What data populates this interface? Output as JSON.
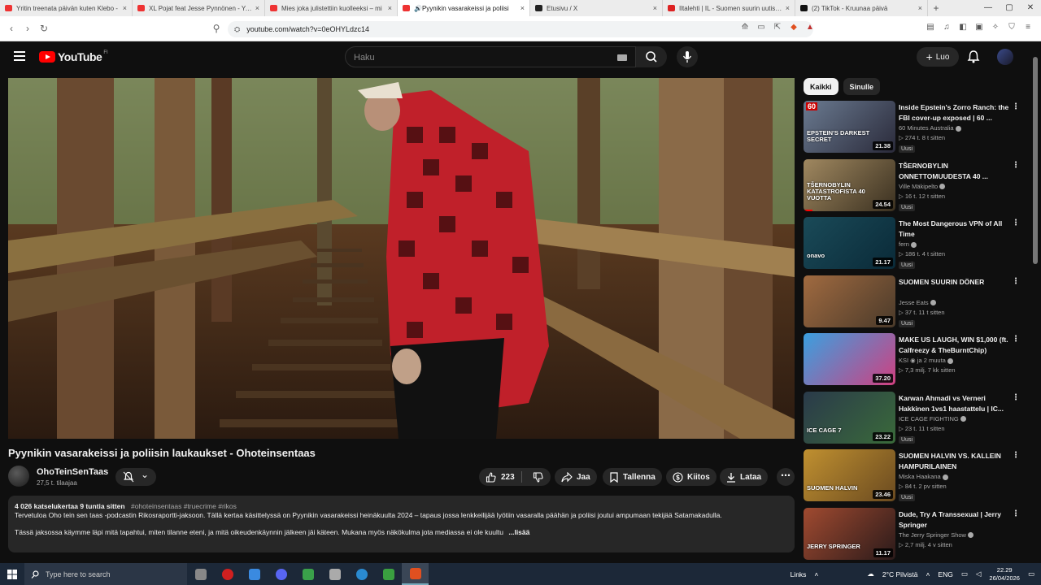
{
  "browser": {
    "tabs": [
      {
        "label": "Yritin treenata päivän kuten Klebo - ",
        "favicon_color": "#e33"
      },
      {
        "label": "XL Pojat feat Jesse Pynnönen - You",
        "favicon_color": "#e33"
      },
      {
        "label": "Mies joka julistettiin kuolleeksi – mi",
        "favicon_color": "#e33"
      },
      {
        "label": "Pyynikin vasarakeissi ja poliisi",
        "favicon_color": "#e33",
        "audio": "🔊"
      },
      {
        "label": "Etusivu / X",
        "favicon_color": "#222"
      },
      {
        "label": "Iltalehti | IL - Suomen suurin uutispa",
        "favicon_color": "#d22"
      },
      {
        "label": "(2) TikTok - Kruunaa päivä",
        "favicon_color": "#111"
      }
    ],
    "close_glyph": "×",
    "new_tab": "+",
    "url": "youtube.com/watch?v=0eOHYLdzc14",
    "window_controls": [
      "—",
      "▢",
      "✕"
    ]
  },
  "header": {
    "logo_word": "YouTube",
    "country_code": "FI",
    "search_placeholder": "Haku",
    "create_label": "Luo",
    "create_plus": "+"
  },
  "video": {
    "title": "Pyynikin vasarakeissi ja poliisin laukaukset - Ohoteinsentaas"
  },
  "channel": {
    "name": "OhoTeinSenTaas",
    "subscribers": "27,5 t. tilaajaa",
    "bell_caret": "⌄"
  },
  "actions": {
    "likes": "223",
    "share": "Jaa",
    "save": "Tallenna",
    "thanks": "Kiitos",
    "download": "Lataa",
    "more": "⋯"
  },
  "description": {
    "meta": "4 026 katselukertaa  9 tuntia sitten",
    "tags": "#ohoteinsentaas #truecrime #rikos",
    "line1": "Tervetuloa Oho tein sen taas -podcastin Rikosraportti-jaksoon. Tällä kertaa käsittelyssä on Pyynikin vasarakeissi heinäkuulta 2024 – tapaus jossa lenkkeilijää lyötiin vasaralla päähän ja poliisi joutui ampumaan tekijää Satamakadulla.",
    "line2": "Tässä jaksossa käymme läpi mitä tapahtui, miten tilanne eteni, ja mitä oikeudenkäynnin jälkeen jäi käteen. Mukana myös näkökulma jota mediassa ei ole kuultu",
    "more": "...lisää"
  },
  "sidebar": {
    "chips": [
      "Kaikki",
      "Sinulle"
    ],
    "menu_glyph": "⋮",
    "new_badge": "Uusi",
    "items": [
      {
        "title": "Inside Epstein's Zorro Ranch: the FBI cover-up exposed | 60 ...",
        "channel": "60 Minutes Australia",
        "stats": "▷ 274 t.  8 t sitten",
        "duration": "21.38",
        "thumb_text": "EPSTEIN'S DARKEST SECRET",
        "thumb_badge": "60",
        "c1": "#6a7a90",
        "c2": "#2a2a3a",
        "new": true,
        "progress": 0
      },
      {
        "title": "TŠERNOBYLIN ONNETTOMUUDESTA 40 ...",
        "channel": "Ville Mäkipelto",
        "stats": "▷ 16 t.  12 t sitten",
        "duration": "24.54",
        "thumb_text": "TŠERNOBYLIN KATASTROFISTA 40 VUOTTA",
        "thumb_badge": "",
        "c1": "#a08860",
        "c2": "#3a3020",
        "new": true,
        "progress": 0.1
      },
      {
        "title": "The Most Dangerous VPN of All Time",
        "channel": "fern",
        "stats": "▷ 186 t.  4 t sitten",
        "duration": "21.17",
        "thumb_text": "onavo",
        "thumb_badge": "",
        "c1": "#1a4a58",
        "c2": "#0a2a38",
        "new": true,
        "progress": 0
      },
      {
        "title": "SUOMEN SUURIN DÖNER",
        "channel": "Jesse Eats",
        "stats": "▷ 37 t.  11 t sitten",
        "duration": "9.47",
        "thumb_text": "",
        "thumb_badge": "",
        "c1": "#a06a40",
        "c2": "#4a3a2a",
        "new": true,
        "progress": 0
      },
      {
        "title": "MAKE US LAUGH, WIN $1,000 (ft. Calfreezy & TheBurntChip)",
        "channel": "KSI ◉ ja 2 muuta",
        "stats": "▷ 7,3 milj.  7 kk sitten",
        "duration": "37.20",
        "thumb_text": "",
        "thumb_badge": "",
        "c1": "#3aa0e0",
        "c2": "#d04080",
        "new": false,
        "progress": 0
      },
      {
        "title": "Karwan Ahmadi vs Verneri Hakkinen 1vs1 haastattelu | IC...",
        "channel": "ICE CAGE FIGHTING",
        "stats": "▷ 23 t.  11 t sitten",
        "duration": "23.22",
        "thumb_text": "ICE CAGE 7",
        "thumb_badge": "",
        "c1": "#2a3a4a",
        "c2": "#3a6a3a",
        "new": true,
        "progress": 0
      },
      {
        "title": "SUOMEN HALVIN VS. KALLEIN HAMPURILAINEN",
        "channel": "Miska Haakana",
        "stats": "▷ 84 t.  2 pv sitten",
        "duration": "23.46",
        "thumb_text": "SUOMEN HALVIN",
        "thumb_badge": "",
        "c1": "#c09030",
        "c2": "#6a4a20",
        "new": true,
        "progress": 0
      },
      {
        "title": "Dude, Try A Transsexual | Jerry Springer",
        "channel": "The Jerry Springer Show",
        "stats": "▷ 2,7 milj.  4 v sitten",
        "duration": "11.17",
        "thumb_text": "JERRY SPRINGER",
        "thumb_badge": "",
        "c1": "#a04a30",
        "c2": "#2a1a1a",
        "new": false,
        "progress": 0
      }
    ]
  },
  "taskbar": {
    "search_placeholder": "Type here to search",
    "links": "Links",
    "weather": "2°C  Pilvistä",
    "lang": "ENG",
    "time": "22.29",
    "date": "26/04/2026",
    "app_colors": [
      "#888",
      "#d02020",
      "#3a8ae0",
      "#5865f2",
      "#3aa04a",
      "#aaa",
      "#2a8ad0",
      "#3aa040",
      "#e05020"
    ]
  }
}
